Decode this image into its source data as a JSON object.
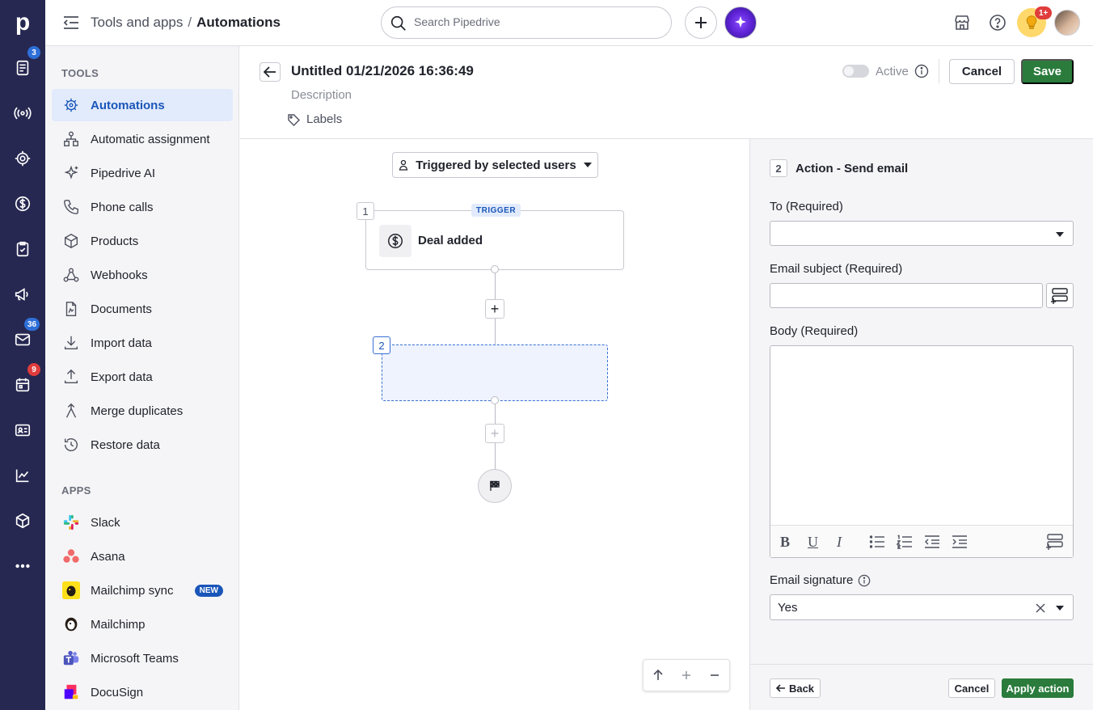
{
  "rail": {
    "logo": "p",
    "badges": {
      "leads": "3",
      "mail": "36",
      "activities": "9"
    },
    "badge_colors": {
      "blue": "#2e6fd8",
      "red": "#e03c3c"
    }
  },
  "topbar": {
    "breadcrumb_parent": "Tools and apps",
    "breadcrumb_separator": "/",
    "breadcrumb_current": "Automations",
    "search_placeholder": "Search Pipedrive",
    "notification_badge": "1+"
  },
  "sidebar": {
    "tools_heading": "TOOLS",
    "tools": [
      {
        "label": "Automations",
        "icon": "automations-icon",
        "active": true
      },
      {
        "label": "Automatic assignment",
        "icon": "assignment-icon"
      },
      {
        "label": "Pipedrive AI",
        "icon": "sparkle-icon"
      },
      {
        "label": "Phone calls",
        "icon": "phone-icon"
      },
      {
        "label": "Products",
        "icon": "box-icon"
      },
      {
        "label": "Webhooks",
        "icon": "webhook-icon"
      },
      {
        "label": "Documents",
        "icon": "document-icon"
      },
      {
        "label": "Import data",
        "icon": "import-icon"
      },
      {
        "label": "Export data",
        "icon": "export-icon"
      },
      {
        "label": "Merge duplicates",
        "icon": "merge-icon"
      },
      {
        "label": "Restore data",
        "icon": "restore-icon"
      }
    ],
    "apps_heading": "APPS",
    "apps": [
      {
        "label": "Slack",
        "icon": "slack-icon"
      },
      {
        "label": "Asana",
        "icon": "asana-icon"
      },
      {
        "label": "Mailchimp sync",
        "icon": "mailchimp-icon",
        "badge": "NEW"
      },
      {
        "label": "Mailchimp",
        "icon": "mailchimp-icon"
      },
      {
        "label": "Microsoft Teams",
        "icon": "teams-icon"
      },
      {
        "label": "DocuSign",
        "icon": "docusign-icon"
      }
    ]
  },
  "editor": {
    "title": "Untitled 01/21/2026 16:36:49",
    "description_placeholder": "Description",
    "labels_text": "Labels",
    "active_label": "Active",
    "cancel_label": "Cancel",
    "save_label": "Save"
  },
  "canvas": {
    "trigger_selector": "Triggered by selected users",
    "step1": {
      "number": "1",
      "tag": "TRIGGER",
      "label": "Deal added"
    },
    "step2": {
      "number": "2"
    }
  },
  "panel": {
    "step_number": "2",
    "title": "Action - Send email",
    "to_label": "To (Required)",
    "to_value": "",
    "subject_label": "Email subject (Required)",
    "subject_value": "",
    "body_label": "Body (Required)",
    "signature_label": "Email signature",
    "signature_value": "Yes",
    "back_label": "Back",
    "cancel_label": "Cancel",
    "apply_label": "Apply action"
  },
  "colors": {
    "rail_bg": "#262851",
    "primary_green": "#2a7b3c",
    "accent_blue": "#1a56b9",
    "active_bg": "#e2ebfc"
  }
}
